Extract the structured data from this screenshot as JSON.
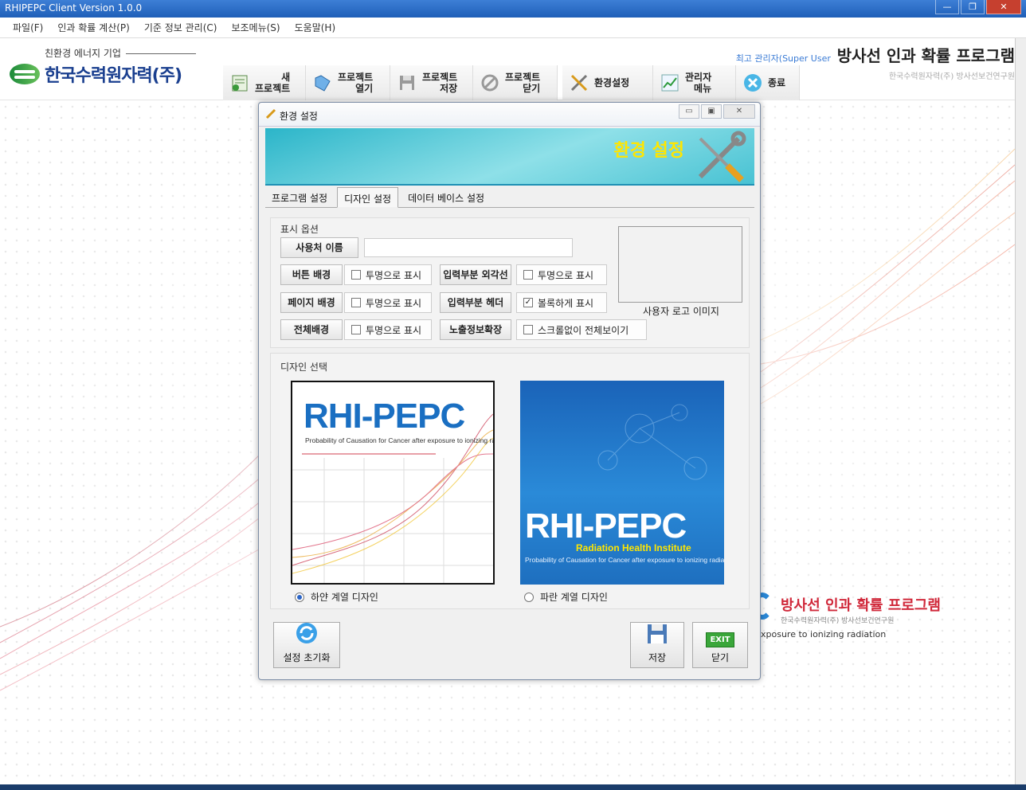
{
  "window": {
    "title": "RHIPEPC Client Version 1.0.0"
  },
  "menu": [
    "파일(F)",
    "인과 확률 계산(P)",
    "기준 정보 관리(C)",
    "보조메뉴(S)",
    "도움말(H)"
  ],
  "logo": {
    "tagline": "친환경 에너지 기업",
    "company": "한국수력원자력(주)"
  },
  "toolbar": {
    "new_project": "새\n프로젝트",
    "open_project": "프로젝트\n열기",
    "save_project": "프로젝트\n저장",
    "close_project": "프로젝트\n닫기",
    "settings": "환경설정",
    "admin_menu": "관리자\n메뉴",
    "exit": "종료"
  },
  "header": {
    "user": "최고 관리자(Super User",
    "program_title": "방사선 인과 확률 프로그램",
    "institute": "한국수력원자력(주) 방사선보건연구원"
  },
  "background": {
    "title": "방사선 인과 확률 프로그램",
    "institute": "한국수력원자력(주) 방사선보건연구원",
    "subtitle": "xposure to ionizing radiation"
  },
  "dialog": {
    "title": "환경 설정",
    "banner_title": "환경 설정",
    "tabs": [
      "프로그램 설정",
      "디자인 설정",
      "데이터 베이스 설정"
    ],
    "active_tab": "디자인 설정",
    "display_options": {
      "title": "표시 옵션",
      "user_name_label": "사용처 이름",
      "user_name_value": "",
      "button_bg_label": "버튼 배경",
      "button_bg_check": "투명으로 표시",
      "input_outline_label": "입력부분 외각선",
      "input_outline_check": "투명으로 표시",
      "page_bg_label": "페이지 배경",
      "page_bg_check": "투명으로 표시",
      "input_header_label": "입력부분 헤더",
      "input_header_check": "볼록하게 표시",
      "all_bg_label": "전체배경",
      "all_bg_check": "투명으로 표시",
      "expose_label": "노출정보확장",
      "expose_check": "스크롤없이 전체보이기",
      "logo_caption": "사용자 로고 이미지",
      "checked": {
        "button_bg": false,
        "input_outline": false,
        "page_bg": false,
        "input_header": true,
        "all_bg": false,
        "expose": false
      }
    },
    "design_select": {
      "title": "디자인 선택",
      "white": {
        "logo": "RHI-PEPC",
        "subtitle": "Probability of Causation for Cancer after exposure to ionizing radiation",
        "radio_label": "하얀 계열 디자인",
        "selected": true
      },
      "blue": {
        "logo": "RHI-PEPC",
        "institute": "Radiation Health Institute",
        "subtitle": "Probability of Causation for Cancer after exposure to ionizing radiation",
        "radio_label": "파란 계열 디자인",
        "selected": false
      }
    },
    "buttons": {
      "reset": "설정 초기화",
      "save": "저장",
      "close": "닫기",
      "exit_badge": "EXIT"
    }
  },
  "colors": {
    "accent": "#2a88d8",
    "banner": "#2bb5c9",
    "banner_title": "#ffe600",
    "brand_red": "#d0283a",
    "brand_blue": "#1a3f8f"
  }
}
